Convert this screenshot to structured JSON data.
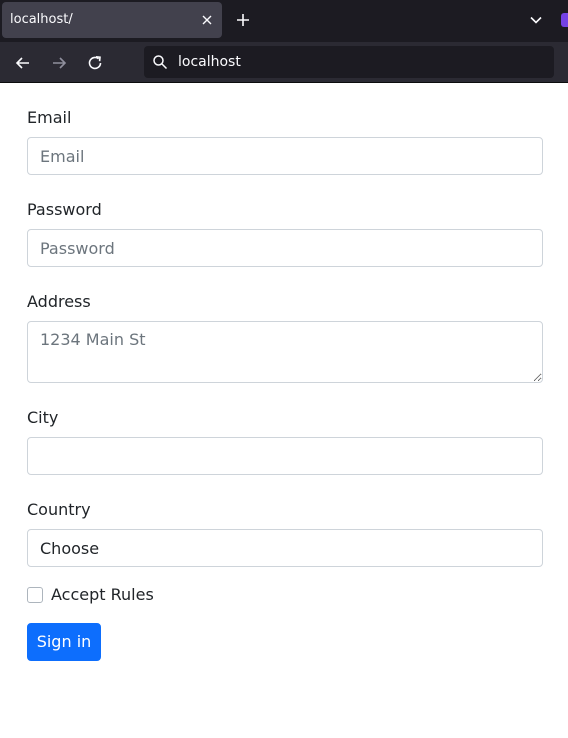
{
  "browser": {
    "tab_title": "localhost/",
    "url": "localhost"
  },
  "form": {
    "email_label": "Email",
    "email_placeholder": "Email",
    "password_label": "Password",
    "password_placeholder": "Password",
    "address_label": "Address",
    "address_placeholder": "1234 Main St",
    "city_label": "City",
    "city_value": "",
    "country_label": "Country",
    "country_selected": "Choose",
    "accept_label": "Accept Rules",
    "accept_checked": false,
    "submit_label": "Sign in"
  },
  "colors": {
    "primary": "#0d6efd",
    "border": "#ced4da",
    "chrome_dark": "#1c1b22",
    "chrome_toolbar": "#2b2a33"
  }
}
